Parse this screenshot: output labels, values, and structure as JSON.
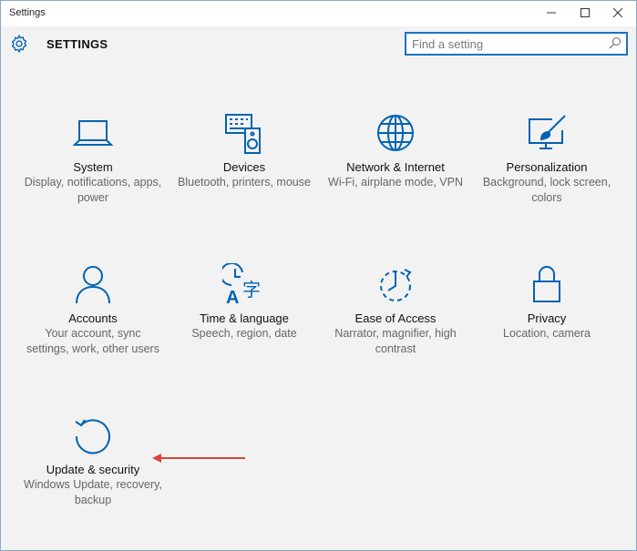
{
  "window": {
    "title": "Settings",
    "minimize_glyph": "—",
    "maximize_glyph": "☐",
    "close_glyph": "✕"
  },
  "header": {
    "heading": "SETTINGS",
    "icon": "gear-icon"
  },
  "search": {
    "placeholder": "Find a setting",
    "value": "",
    "icon": "search-icon"
  },
  "accent_color": "#0063b1",
  "annotation_color": "#d9453c",
  "tiles": [
    {
      "label": "System",
      "description": "Display, notifications, apps, power",
      "icon": "laptop-icon"
    },
    {
      "label": "Devices",
      "description": "Bluetooth, printers, mouse",
      "icon": "devices-icon"
    },
    {
      "label": "Network & Internet",
      "description": "Wi-Fi, airplane mode, VPN",
      "icon": "globe-icon"
    },
    {
      "label": "Personalization",
      "description": "Background, lock screen, colors",
      "icon": "paint-icon"
    },
    {
      "label": "Accounts",
      "description": "Your account, sync settings, work, other users",
      "icon": "person-icon"
    },
    {
      "label": "Time & language",
      "description": "Speech, region, date",
      "icon": "time-language-icon"
    },
    {
      "label": "Ease of Access",
      "description": "Narrator, magnifier, high contrast",
      "icon": "ease-of-access-icon"
    },
    {
      "label": "Privacy",
      "description": "Location, camera",
      "icon": "lock-icon"
    },
    {
      "label": "Update & security",
      "description": "Windows Update, recovery, backup",
      "icon": "update-icon"
    }
  ]
}
